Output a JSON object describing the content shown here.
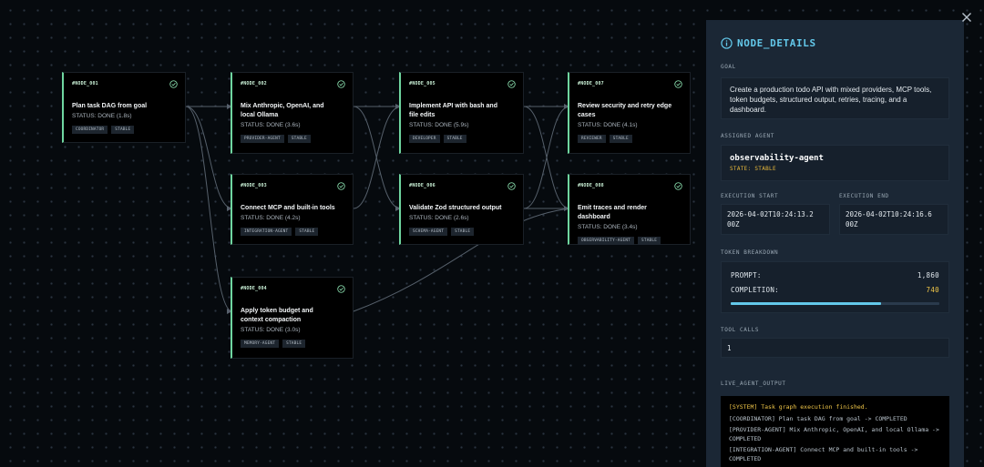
{
  "graph": {
    "nodes": [
      {
        "id": "#NODE_001",
        "title": "Plan task DAG from goal",
        "status": "STATUS: DONE (1.8s)",
        "agent": "COORDINATOR",
        "badge": "STABLE"
      },
      {
        "id": "#NODE_002",
        "title": "Mix Anthropic, OpenAI, and local Ollama",
        "status": "STATUS: DONE (3.6s)",
        "agent": "PROVIDER-AGENT",
        "badge": "STABLE"
      },
      {
        "id": "#NODE_003",
        "title": "Connect MCP and built-in tools",
        "status": "STATUS: DONE (4.2s)",
        "agent": "INTEGRATION-AGENT",
        "badge": "STABLE"
      },
      {
        "id": "#NODE_004",
        "title": "Apply token budget and context compaction",
        "status": "STATUS: DONE (3.0s)",
        "agent": "MEMORY-AGENT",
        "badge": "STABLE"
      },
      {
        "id": "#NODE_005",
        "title": "Implement API with bash and file edits",
        "status": "STATUS: DONE (5.9s)",
        "agent": "DEVELOPER",
        "badge": "STABLE"
      },
      {
        "id": "#NODE_006",
        "title": "Validate Zod structured output",
        "status": "STATUS: DONE (2.6s)",
        "agent": "SCHEMA-AGENT",
        "badge": "STABLE"
      },
      {
        "id": "#NODE_007",
        "title": "Review security and retry edge cases",
        "status": "STATUS: DONE (4.1s)",
        "agent": "REVIEWER",
        "badge": "STABLE"
      },
      {
        "id": "#NODE_008",
        "title": "Emit traces and render dashboard",
        "status": "STATUS: DONE (3.4s)",
        "agent": "OBSERVABILITY-AGENT",
        "badge": "STABLE"
      }
    ]
  },
  "panel": {
    "title": "NODE_DETAILS",
    "goal_label": "GOAL",
    "goal_text": "Create a production todo API with mixed providers, MCP tools, token budgets, structured output, retries, tracing, and a dashboard.",
    "agent_label": "ASSIGNED AGENT",
    "agent_name": "observability-agent",
    "agent_state": "STATE: STABLE",
    "exec_start_label": "EXECUTION START",
    "exec_start": "2026-04-02T10:24:13.200Z",
    "exec_end_label": "EXECUTION END",
    "exec_end": "2026-04-02T10:24:16.600Z",
    "tokens_label": "TOKEN BREAKDOWN",
    "prompt_label": "PROMPT:",
    "prompt_value": "1,860",
    "completion_label": "COMPLETION:",
    "completion_value": "740",
    "token_progress_fraction": 0.72,
    "tool_calls_label": "TOOL CALLS",
    "tool_calls": "1",
    "output_label": "LIVE_AGENT_OUTPUT",
    "output_lines": [
      "[SYSTEM] Task graph execution finished.",
      "[COORDINATOR] Plan task DAG from goal -> COMPLETED",
      "[PROVIDER-AGENT] Mix Anthropic, OpenAI, and local Ollama -> COMPLETED",
      "[INTEGRATION-AGENT] Connect MCP and built-in tools -> COMPLETED"
    ]
  },
  "colors": {
    "accent": "#63c8ea",
    "node_accent": "#6fd6a0",
    "state": "#e7b83a",
    "completion": "#f0c648"
  },
  "icons": {
    "close": "close-icon",
    "info": "info-icon",
    "check": "check-circle-icon"
  }
}
